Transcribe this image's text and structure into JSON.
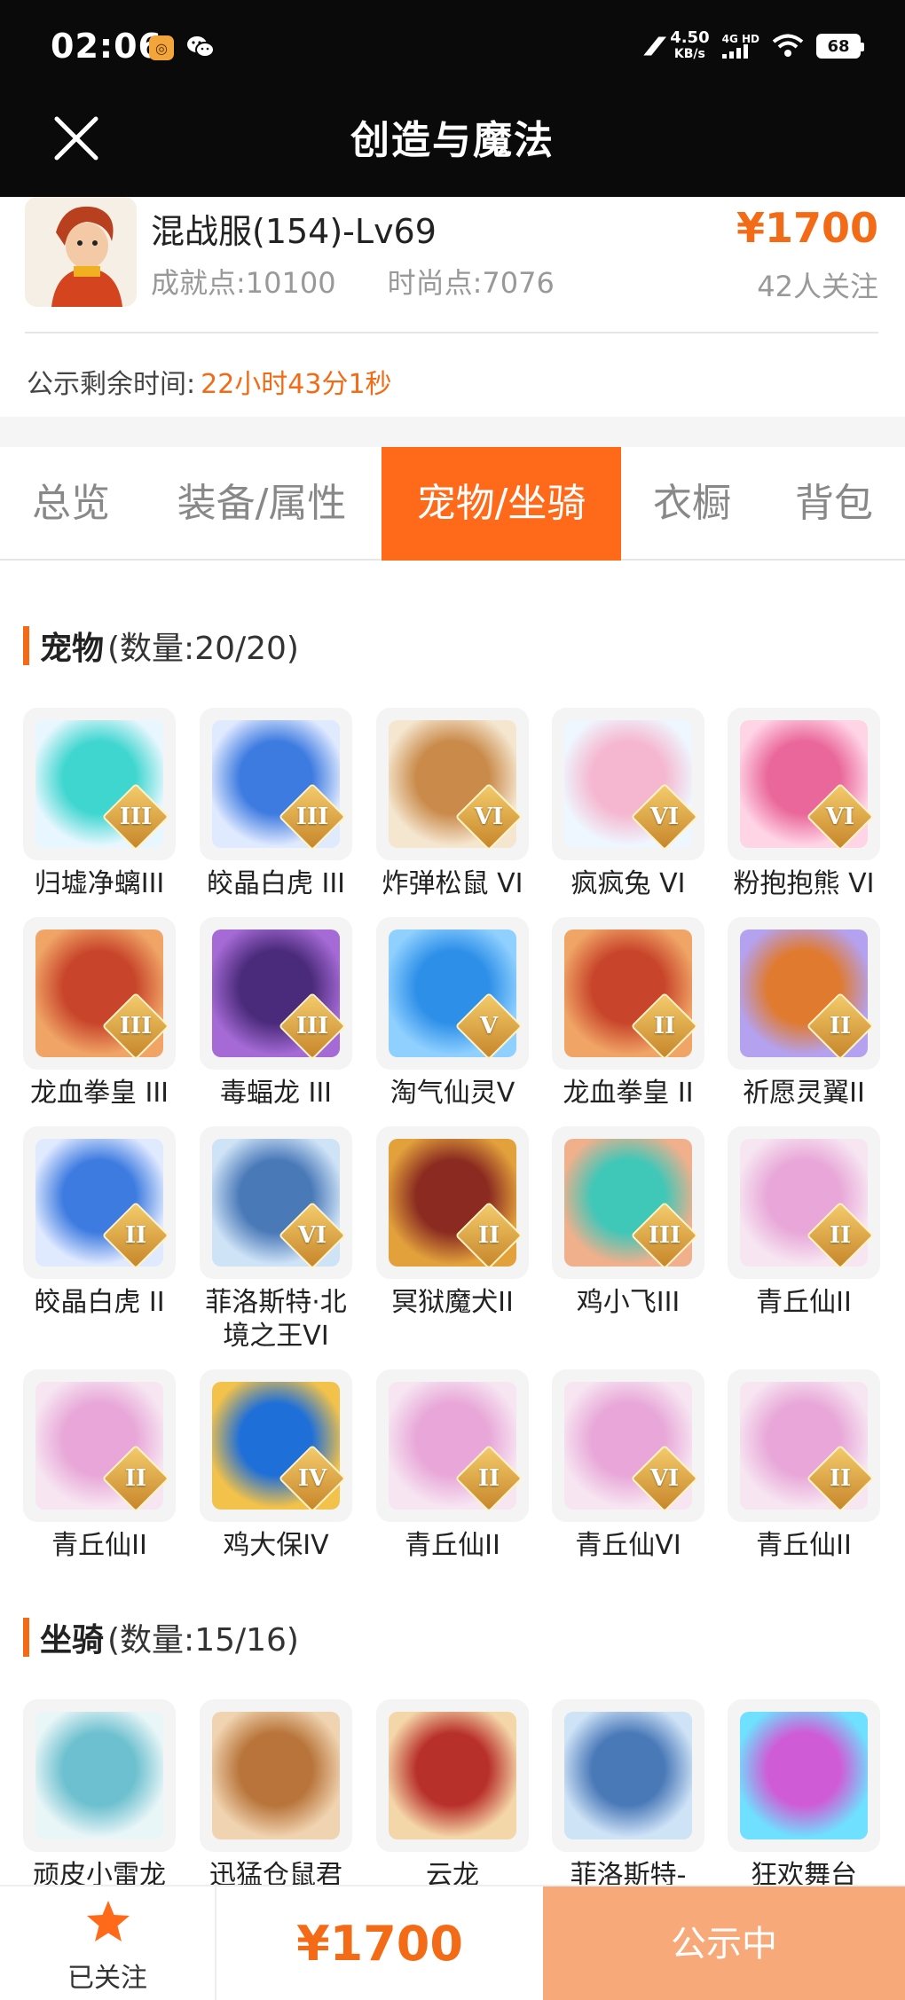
{
  "status_bar": {
    "time": "02:06",
    "net_speed_value": "4.50",
    "net_speed_unit": "KB/s",
    "network_type": "4G HD",
    "battery": "68"
  },
  "header": {
    "title": "创造与魔法"
  },
  "listing": {
    "character": "混战服(154)-Lv69",
    "achievement": "成就点:10100",
    "fashion": "时尚点:7076",
    "price": "¥1700",
    "followers": "42人关注",
    "remaining_label": "公示剩余时间:",
    "remaining_value": "22小时43分1秒"
  },
  "tabs": [
    {
      "label": "总览"
    },
    {
      "label": "装备/属性"
    },
    {
      "label": "宠物/坐骑"
    },
    {
      "label": "衣橱"
    },
    {
      "label": "背包"
    }
  ],
  "active_tab": "宠物/坐骑",
  "pets": {
    "title": "宠物",
    "count": "(数量:20/20)",
    "items": [
      {
        "name": "归墟净螭III",
        "rank": "III",
        "colors": [
          "#3fd6d0",
          "#e8f7ff"
        ]
      },
      {
        "name": "皎晶白虎 III",
        "rank": "III",
        "colors": [
          "#3d7be0",
          "#dfe9ff"
        ]
      },
      {
        "name": "炸弹松鼠 VI",
        "rank": "VI",
        "colors": [
          "#c98a4a",
          "#f5e6cf"
        ]
      },
      {
        "name": "疯疯兔 VI",
        "rank": "VI",
        "colors": [
          "#f5b7cf",
          "#eef7ff"
        ]
      },
      {
        "name": "粉抱抱熊 VI",
        "rank": "VI",
        "colors": [
          "#e9679a",
          "#ffd5e6"
        ]
      },
      {
        "name": "龙血拳皇 III",
        "rank": "III",
        "colors": [
          "#c8452b",
          "#f0a566"
        ]
      },
      {
        "name": "毒蝠龙 III",
        "rank": "III",
        "colors": [
          "#4a2a7a",
          "#a56ad6"
        ]
      },
      {
        "name": "淘气仙灵V",
        "rank": "V",
        "colors": [
          "#2d8fe8",
          "#8fd0ff"
        ]
      },
      {
        "name": "龙血拳皇 II",
        "rank": "II",
        "colors": [
          "#c8452b",
          "#f0a566"
        ]
      },
      {
        "name": "祈愿灵翼II",
        "rank": "II",
        "colors": [
          "#e07a2f",
          "#b4a2f0"
        ]
      },
      {
        "name": "皎晶白虎 II",
        "rank": "II",
        "colors": [
          "#3d7be0",
          "#dfe9ff"
        ]
      },
      {
        "name": "菲洛斯特·北境之王VI",
        "rank": "VI",
        "colors": [
          "#4a79b8",
          "#cfe3f7"
        ]
      },
      {
        "name": "冥狱魔犬II",
        "rank": "II",
        "colors": [
          "#8a2a20",
          "#e2a13b"
        ]
      },
      {
        "name": "鸡小飞III",
        "rank": "III",
        "colors": [
          "#3fc7b8",
          "#f0b08c"
        ]
      },
      {
        "name": "青丘仙II",
        "rank": "II",
        "colors": [
          "#e8a7d8",
          "#f7e6f2"
        ]
      },
      {
        "name": "青丘仙II",
        "rank": "II",
        "colors": [
          "#e8a7d8",
          "#f7e6f2"
        ]
      },
      {
        "name": "鸡大保IV",
        "rank": "IV",
        "colors": [
          "#1f6fd8",
          "#f2c24a"
        ]
      },
      {
        "name": "青丘仙II",
        "rank": "II",
        "colors": [
          "#e8a7d8",
          "#f7e6f2"
        ]
      },
      {
        "name": "青丘仙VI",
        "rank": "VI",
        "colors": [
          "#e8a7d8",
          "#f7e6f2"
        ]
      },
      {
        "name": "青丘仙II",
        "rank": "II",
        "colors": [
          "#e8a7d8",
          "#f7e6f2"
        ]
      }
    ]
  },
  "mounts": {
    "title": "坐骑",
    "count": "(数量:15/16)",
    "items": [
      {
        "name": "顽皮小雷龙",
        "colors": [
          "#6cc0cf",
          "#e9f6f8"
        ]
      },
      {
        "name": "迅猛仓鼠君",
        "colors": [
          "#b8743a",
          "#f0d3b0"
        ]
      },
      {
        "name": "云龙",
        "colors": [
          "#b8302a",
          "#f4d7a8"
        ]
      },
      {
        "name": "菲洛斯特-",
        "colors": [
          "#4a79b8",
          "#cfe3f7"
        ]
      },
      {
        "name": "狂欢舞台",
        "colors": [
          "#d05bd6",
          "#6fe0ff"
        ]
      }
    ]
  },
  "bottom_bar": {
    "follow_label": "已关注",
    "price": "¥1700",
    "status_label": "公示中"
  },
  "colors": {
    "accent": "#f36b16",
    "tab_active": "#ff6a1a",
    "status_btn": "#f8a97a"
  }
}
